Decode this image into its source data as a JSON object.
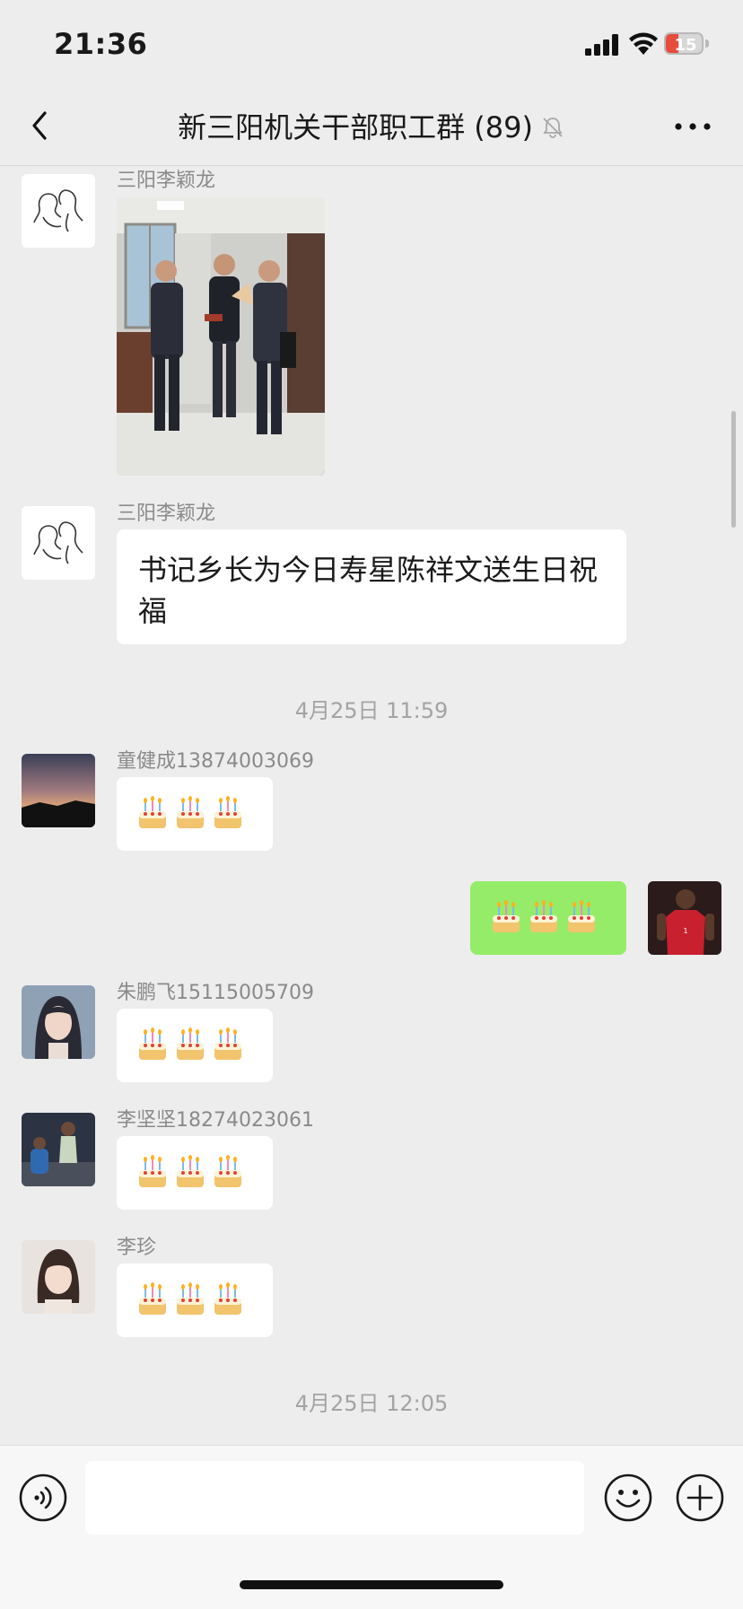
{
  "status_bar": {
    "time": "21:36",
    "battery_level": "15"
  },
  "header": {
    "title": "新三阳机关干部职工群 (89)",
    "muted": true
  },
  "messages": [
    {
      "type": "image",
      "sender": "三阳李颖龙"
    },
    {
      "type": "text",
      "sender": "三阳李颖龙",
      "text": "书记乡长为今日寿星陈祥文送生日祝福"
    },
    {
      "type": "time",
      "text": "4月25日 11:59"
    },
    {
      "type": "emoji",
      "sender": "童健成13874003069",
      "emoji": "🎂🎂🎂"
    },
    {
      "type": "emoji",
      "sender": "",
      "mine": true,
      "emoji": "🎂🎂🎂"
    },
    {
      "type": "emoji",
      "sender": "朱鹏飞15115005709",
      "emoji": "🎂🎂🎂"
    },
    {
      "type": "emoji",
      "sender": "李坚坚18274023061",
      "emoji": "🎂🎂🎂"
    },
    {
      "type": "emoji",
      "sender": "李珍",
      "emoji": "🎂🎂🎂"
    },
    {
      "type": "time",
      "text": "4月25日 12:05"
    }
  ],
  "input": {
    "value": ""
  },
  "colors": {
    "background": "#ededed",
    "mine_bubble": "#95ec69",
    "bubble": "#ffffff",
    "battery_low": "#e74c3c"
  },
  "icons": [
    "back-icon",
    "mute-bell-icon",
    "more-icon",
    "voice-icon",
    "emoji-icon",
    "plus-icon"
  ]
}
